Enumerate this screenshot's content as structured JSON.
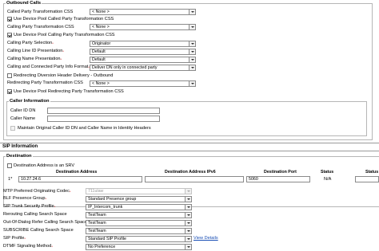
{
  "outbound": {
    "legend": "Outbound Calls",
    "called_xform_label": "Called Party Transformation CSS",
    "called_xform_value": "< None >",
    "use_pool_called_label": "Use Device Pool Called Party Transformation CSS",
    "calling_xform_label": "Calling Party Transformation CSS",
    "calling_xform_value": "< None >",
    "use_pool_calling_label": "Use Device Pool Calling Party Transformation CSS",
    "calling_selection_label": "Calling Party Selection",
    "calling_selection_value": "Originator",
    "calling_line_pres_label": "Calling Line ID Presentation",
    "calling_line_pres_value": "Default",
    "calling_name_pres_label": "Calling Name Presentation",
    "calling_name_pres_value": "Default",
    "connected_format_label": "Calling and Connected Party Info Format",
    "connected_format_value": "Deliver DN only in connected party",
    "redirecting_delivery_label": "Redirecting Diversion Header Delivery - Outbound",
    "redirecting_xform_label": "Redirecting Party Transformation CSS",
    "redirecting_xform_value": "< None >",
    "use_pool_redirecting_label": "Use Device Pool Redirecting Party Transformation CSS"
  },
  "caller_info": {
    "legend": "Caller Information",
    "caller_id_dn_label": "Caller ID DN",
    "caller_id_dn_value": "",
    "caller_name_label": "Caller Name",
    "caller_name_value": "",
    "maintain_label": "Maintain Original Caller ID DN and Caller Name in Identity Headers"
  },
  "sip_info": {
    "title": "SIP Information",
    "destination_legend": "Destination",
    "srv_label": "Destination Address is an SRV",
    "columns": [
      "Destination Address",
      "Destination Address IPv6",
      "Destination Port",
      "Status",
      "Status"
    ],
    "rows": [
      {
        "index": "1*",
        "address": "10.27.24.6",
        "ipv6": "",
        "port": "5060",
        "status": "N/A"
      }
    ]
  },
  "sip_settings": [
    {
      "label": "MTP Preferred Originating Codec",
      "required": true,
      "value": "711ulaw",
      "disabled": true
    },
    {
      "label": "BLF Presence Group",
      "required": true,
      "value": "Standard Presence group",
      "disabled": false
    },
    {
      "label": "SIP Trunk Security Profile",
      "required": true,
      "value": "IP_Intercom_trunk",
      "disabled": false
    },
    {
      "label": "Rerouting Calling Search Space",
      "required": false,
      "value": "TestTeam",
      "disabled": false
    },
    {
      "label": "Out-Of-Dialog Refer Calling Search Space",
      "required": false,
      "value": "TestTeam",
      "disabled": false
    },
    {
      "label": "SUBSCRIBE Calling Search Space",
      "required": false,
      "value": "TestTeam",
      "disabled": false
    },
    {
      "label": "SIP Profile",
      "required": true,
      "value": "Standard SIP Profile",
      "disabled": false
    },
    {
      "label": "DTMF Signaling Method",
      "required": true,
      "value": "No Preference",
      "disabled": false
    }
  ],
  "view_details_label": "View Details",
  "required_marker": "*",
  "colors": {
    "required": "#cc0000",
    "link": "#1a4fb5",
    "border": "#b6b6b6"
  }
}
